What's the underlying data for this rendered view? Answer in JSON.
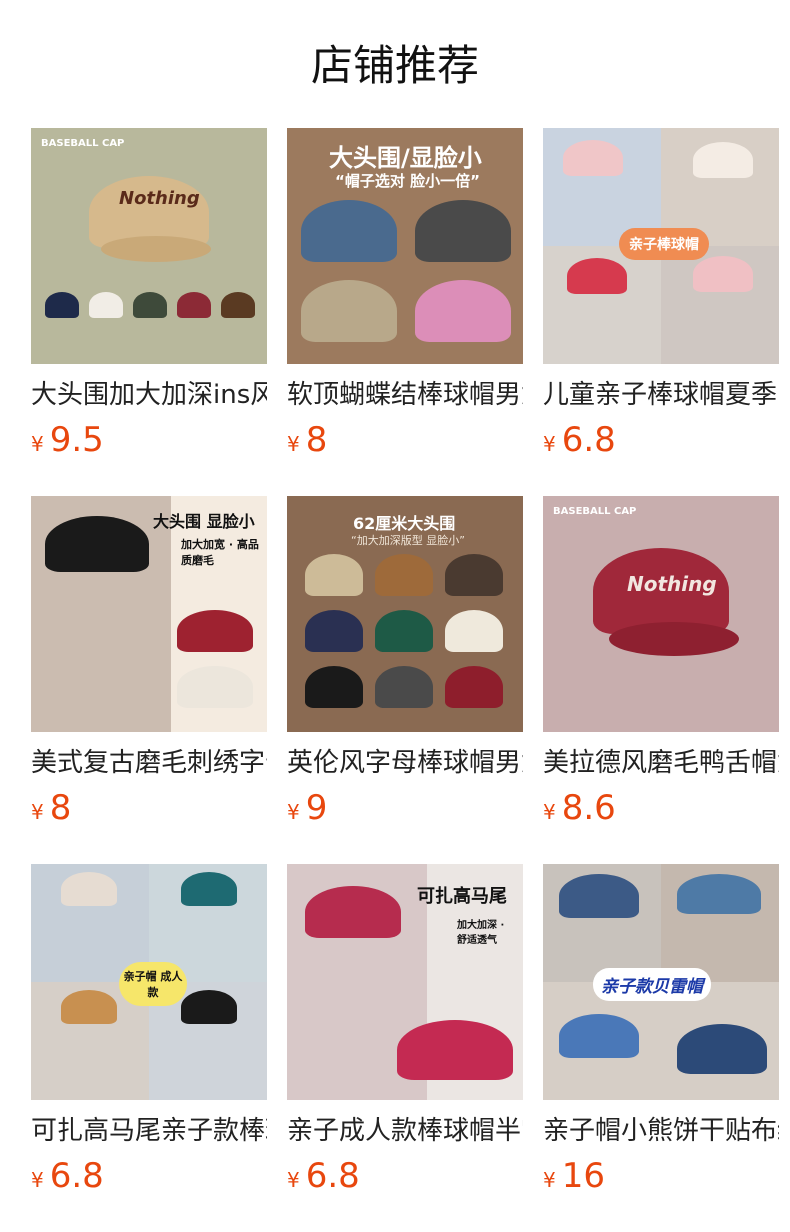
{
  "header": {
    "title": "店铺推荐"
  },
  "colors": {
    "price": "#e8470e",
    "title": "#222222"
  },
  "products": [
    {
      "title": "大头围加大加深ins风",
      "currency": "¥",
      "price": "9.5",
      "image_badge": "BASEBALL CAP",
      "image_text": "Nothing"
    },
    {
      "title": "软顶蝴蝶结棒球帽男女",
      "currency": "¥",
      "price": "8",
      "image_badge": "大头围/显脸小",
      "image_text": "“帽子选对 脸小一倍”"
    },
    {
      "title": "儿童亲子棒球帽夏季",
      "currency": "¥",
      "price": "6.8",
      "image_badge": "亲子棒球帽",
      "image_text": ""
    },
    {
      "title": "美式复古磨毛刺绣字母",
      "currency": "¥",
      "price": "8",
      "image_badge": "大头围 显脸小",
      "image_text": "加大加宽 · 高品质磨毛"
    },
    {
      "title": "英伦风字母棒球帽男女",
      "currency": "¥",
      "price": "9",
      "image_badge": "62厘米大头围",
      "image_text": "“加大加深版型 显脸小”"
    },
    {
      "title": "美拉德风磨毛鸭舌帽女",
      "currency": "¥",
      "price": "8.6",
      "image_badge": "BASEBALL CAP",
      "image_text": "Nothing"
    },
    {
      "title": "可扎高马尾亲子款棒球",
      "currency": "¥",
      "price": "6.8",
      "image_badge": "亲子帽 成人款",
      "image_text": ""
    },
    {
      "title": "亲子成人款棒球帽半空",
      "currency": "¥",
      "price": "6.8",
      "image_badge": "可扎高马尾",
      "image_text": "加大加深 · 舒适透气"
    },
    {
      "title": "亲子帽小熊饼干贴布绣",
      "currency": "¥",
      "price": "16",
      "image_badge": "亲子款贝雷帽",
      "image_text": ""
    }
  ]
}
